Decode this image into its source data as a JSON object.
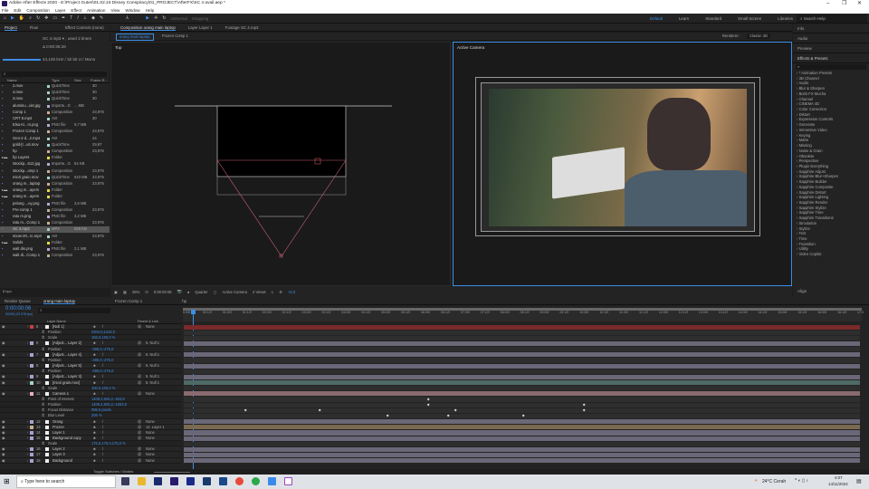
{
  "window": {
    "title": "Adobe After Effects 2020 - E:\\Project Guteri\\01.02.24 Disney Conspiracy\\01_PROJECT\\AfterFX\\SC 4 avail.aep *",
    "minimize": "–",
    "maximize": "❐",
    "close": "✕"
  },
  "menu": [
    "File",
    "Edit",
    "Composition",
    "Layer",
    "Effect",
    "Animation",
    "View",
    "Window",
    "Help"
  ],
  "toolbar": {
    "universal": "Universal",
    "snapping": "Snapping"
  },
  "workspaces": [
    "Default",
    "Learn",
    "Standard",
    "Small Screen",
    "Libraries"
  ],
  "search_help": "Search Help",
  "project": {
    "tabs": [
      "Project",
      "Flow",
      "Effect Controls (none)"
    ],
    "selected_name": "SC 4.mp3 ▾ , used 2 times",
    "duration": "Δ 0:00:35:26",
    "audio_info": "44,100 kHz / 32 bit U / Mono",
    "columns": [
      "Name",
      "Type",
      "Size",
      "Frame R..."
    ],
    "items": [
      {
        "name": "2.mov",
        "type": "QuickTime",
        "size": "",
        "fps": "30",
        "color": "#9fd4c8"
      },
      {
        "name": "4.mov",
        "type": "QuickTime",
        "size": "",
        "fps": "30",
        "color": "#9fd4c8"
      },
      {
        "name": "3.mov",
        "type": "QuickTime",
        "size": "",
        "fps": "30",
        "color": "#9fd4c8"
      },
      {
        "name": "aluminu...ukr.jpg",
        "type": "Importe...G",
        "size": "... MB",
        "fps": "",
        "color": "#b8a8d8"
      },
      {
        "name": "Comp 1",
        "type": "Composition",
        "size": "",
        "fps": "23,976",
        "color": "#c8b090"
      },
      {
        "name": "CRT 8.mp4",
        "type": "AVI",
        "size": "",
        "fps": "30",
        "color": "#9fd4c8"
      },
      {
        "name": "Elsa Ki...m.png",
        "type": "PNG file",
        "size": "9,7 MB",
        "fps": "",
        "color": "#b8a8d8"
      },
      {
        "name": "Frozen Comp 1",
        "type": "Composition",
        "size": "",
        "fps": "23,976",
        "color": "#c8b090"
      },
      {
        "name": "Gen-2 d...2.mp4",
        "type": "AVI",
        "size": "",
        "fps": "24",
        "color": "#9fd4c8"
      },
      {
        "name": "gold-[t...uti.mov",
        "type": "QuickTime",
        "size": "",
        "fps": "29,97",
        "color": "#9fd4c8"
      },
      {
        "name": "hp",
        "type": "Composition",
        "size": "",
        "fps": "23,976",
        "color": "#c8b090"
      },
      {
        "name": "hp Layers",
        "type": "Folder",
        "size": "",
        "fps": "",
        "color": "#e8d84a"
      },
      {
        "name": "istockp...612.jpg",
        "type": "Importe...G",
        "size": "54 KB",
        "fps": "",
        "color": "#b8a8d8"
      },
      {
        "name": "istockp...omp 1",
        "type": "Composition",
        "size": "",
        "fps": "23,976",
        "color": "#c8b090"
      },
      {
        "name": "miori grain.mov",
        "type": "QuickTime",
        "size": "610 MB",
        "fps": "23,976",
        "color": "#9fd4c8"
      },
      {
        "name": "orang m...laptop",
        "type": "Composition",
        "size": "",
        "fps": "23,976",
        "color": "#c8b090"
      },
      {
        "name": "orang m...ayers",
        "type": "Folder",
        "size": "",
        "fps": "",
        "color": "#e8d84a"
      },
      {
        "name": "orang m...ayers",
        "type": "Folder",
        "size": "",
        "fps": "",
        "color": "#e8d84a"
      },
      {
        "name": "pelung ...ey.png",
        "type": "PNG file",
        "size": "3,6 MB",
        "fps": "",
        "color": "#b8a8d8"
      },
      {
        "name": "Pre-comp 1",
        "type": "Composition",
        "size": "",
        "fps": "23,976",
        "color": "#c8b090"
      },
      {
        "name": "ratu m.png",
        "type": "PNG file",
        "size": "3,2 MB",
        "fps": "",
        "color": "#b8a8d8"
      },
      {
        "name": "ratu m...Comp 1",
        "type": "Composition",
        "size": "",
        "fps": "23,976",
        "color": "#c8b090"
      },
      {
        "name": "SC 4.mp3",
        "type": "MP3",
        "size": "559 KB",
        "fps": "",
        "color": "#9fd4c8"
      },
      {
        "name": "snow-20...tc.mp4",
        "type": "AVI",
        "size": "",
        "fps": "23,976",
        "color": "#9fd4c8"
      },
      {
        "name": "Solids",
        "type": "Folder",
        "size": "",
        "fps": "",
        "color": "#e8d84a"
      },
      {
        "name": "walt dis.png",
        "type": "PNG file",
        "size": "2,1 MB",
        "fps": "",
        "color": "#b8a8d8"
      },
      {
        "name": "walt di...Comp 1",
        "type": "Composition",
        "size": "",
        "fps": "23,976",
        "color": "#c8b090"
      }
    ],
    "bpc": "8 bpc"
  },
  "viewer": {
    "tabs": [
      "Composition orang main laptop",
      "Layer Layer 1",
      "Footage SC 4.mp3"
    ],
    "breadcrumbs": [
      "orang main laptop",
      "Frozen Comp 1"
    ],
    "renderer_label": "Renderer:",
    "renderer": "Classic 3D",
    "left_view": "Top",
    "right_view": "Active Camera",
    "zoom": "25%",
    "timecode": "0:00:00:06",
    "resolution": "Quarter",
    "camera": "Active Camera",
    "views": "2 Views",
    "exposure": "+0,0"
  },
  "right_panel": {
    "sections": [
      "Info",
      "Audio",
      "Preview",
      "Effects & Presets"
    ],
    "effects": [
      "* Animation Presets",
      "3D Channel",
      "Audio",
      "Blur & Sharpen",
      "Boris FX Mocha",
      "Channel",
      "CINEMA 4D",
      "Color Correction",
      "Distort",
      "Expression Controls",
      "Generate",
      "Immersive Video",
      "Keying",
      "Matte",
      "Missing",
      "Noise & Grain",
      "Obsolete",
      "Perspective",
      "Plugin Everything",
      "Sapphire Adjust",
      "Sapphire Blur+Sharpen",
      "Sapphire Builder",
      "Sapphire Composite",
      "Sapphire Distort",
      "Sapphire Lighting",
      "Sapphire Render",
      "Sapphire Stylize",
      "Sapphire Time",
      "Sapphire Transitions",
      "Simulation",
      "Stylize",
      "Text",
      "Time",
      "Transition",
      "Utility",
      "Video Copilot"
    ],
    "align": "Align"
  },
  "timeline": {
    "tabs": [
      "Render Queue",
      "orang main laptop",
      "Frozen Comp 1",
      "hp"
    ],
    "timecode": "0:00:00:06",
    "frames": "00006 (23.976 fps)",
    "col_layer": "Layer Name",
    "col_parent": "Parent & Link",
    "toggle": "Toggle Switches / Modes",
    "ruler": [
      "0:00f",
      "00:12f",
      "01:00f",
      "01:12f",
      "02:00f",
      "02:12f",
      "03:00f",
      "03:12f",
      "04:00f",
      "04:12f",
      "05:00f",
      "05:12f",
      "06:00f",
      "06:12f",
      "07:00f",
      "07:12f",
      "08:00f",
      "08:12f",
      "09:00f",
      "09:12f",
      "10:00f",
      "10:12f",
      "11:00f",
      "11:12f",
      "12:00f",
      "12:12f",
      "13:00f",
      "13:12f",
      "14:00f",
      "14:12f",
      "15:00f",
      "15:12f",
      "16:00f",
      "16:12f",
      "17:0"
    ],
    "playhead_time": "0:00:00:06",
    "rows": [
      {
        "kind": "layer",
        "num": "5",
        "name": "[Null 1]",
        "parent": "None",
        "label": "#c84040",
        "track": "#7a2a2a"
      },
      {
        "kind": "prop",
        "name": "Position",
        "value": "2204,0,1232,0"
      },
      {
        "kind": "prop",
        "name": "Scale",
        "value": "155,0,155,0 %"
      },
      {
        "kind": "layer",
        "num": "6",
        "name": "[Adjust... Layer 2]",
        "parent": "5. Null 1",
        "label": "#a8a0d0",
        "track": "#6a6878"
      },
      {
        "kind": "prop",
        "name": "Position",
        "value": "-496,0,-276,0"
      },
      {
        "kind": "layer",
        "num": "7",
        "name": "[Adjust... Layer 4]",
        "parent": "5. Null 1",
        "label": "#a8a0d0",
        "track": "#6a6878"
      },
      {
        "kind": "prop",
        "name": "Position",
        "value": "-496,0,-276,0"
      },
      {
        "kind": "layer",
        "num": "8",
        "name": "[Adjust... Layer 5]",
        "parent": "5. Null 1",
        "label": "#a8a0d0",
        "track": "#6a6878"
      },
      {
        "kind": "prop",
        "name": "Position",
        "value": "-496,0,-276,0"
      },
      {
        "kind": "layer",
        "num": "9",
        "name": "[Adjust... Layer 3]",
        "parent": "5. Null 1",
        "label": "#a8a0d0",
        "track": "#6a6878"
      },
      {
        "kind": "layer",
        "num": "10",
        "name": "[miori grain.mov]",
        "parent": "5. Null 1",
        "label": "#9fd4c8",
        "track": "#4e6a66"
      },
      {
        "kind": "prop",
        "name": "Scale",
        "value": "100,0,100,0 %"
      },
      {
        "kind": "layer",
        "num": "11",
        "name": "Camera 1",
        "parent": "None",
        "label": "#e8b0c0",
        "track": "#8a6a70"
      },
      {
        "kind": "prop",
        "name": "Point of Interest",
        "value": "1409,2,825,2,-453,8",
        "keys": [
          0.36
        ]
      },
      {
        "kind": "prop",
        "name": "Position",
        "value": "1409,4,825,2,-1653,8",
        "keys": [
          0.36,
          0.59
        ]
      },
      {
        "kind": "prop",
        "name": "Focus Distance",
        "value": "998,6 pixels",
        "keys": [
          0.09,
          0.2,
          0.4,
          0.59
        ]
      },
      {
        "kind": "prop",
        "name": "Blur Level",
        "value": "206 %",
        "keys": [
          0.3,
          0.39,
          0.5
        ]
      },
      {
        "kind": "layer",
        "num": "12",
        "name": "Orang",
        "parent": "None",
        "label": "#a8a0d0",
        "track": "#6a6878"
      },
      {
        "kind": "layer",
        "num": "13",
        "name": "Frozen",
        "parent": "14. Layer 1",
        "label": "#c8b090",
        "track": "#7a6a50"
      },
      {
        "kind": "layer",
        "num": "14",
        "name": "Layer 1",
        "parent": "None",
        "label": "#a8a0d0",
        "track": "#6a6878"
      },
      {
        "kind": "layer",
        "num": "15",
        "name": "Background copy",
        "parent": "None",
        "label": "#a8a0d0",
        "track": "#6a6878"
      },
      {
        "kind": "prop",
        "name": "Scale",
        "value": "175,0,175,0,175,0 %"
      },
      {
        "kind": "layer",
        "num": "16",
        "name": "Layer 2",
        "parent": "None",
        "label": "#a8a0d0",
        "track": "#6a6878"
      },
      {
        "kind": "layer",
        "num": "17",
        "name": "Layer 3",
        "parent": "None",
        "label": "#a8a0d0",
        "track": "#6a6878"
      },
      {
        "kind": "layer",
        "num": "18",
        "name": "Background",
        "parent": "None",
        "label": "#a8a0d0",
        "track": "#6a6878"
      }
    ]
  },
  "taskbar": {
    "search": "Type here to search",
    "weather": "24°C Cerah",
    "time": "4:07",
    "date": "14/11/2024"
  },
  "colors": {
    "accent": "#3d8ee8"
  }
}
